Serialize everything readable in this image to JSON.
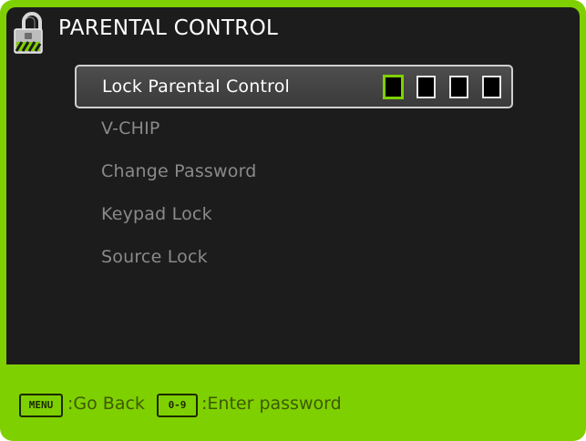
{
  "header": {
    "title": "PARENTAL CONTROL",
    "icon": "padlock-icon"
  },
  "menu": {
    "items": [
      {
        "label": "Lock Parental Control",
        "selected": true
      },
      {
        "label": "V-CHIP",
        "selected": false
      },
      {
        "label": "Change Password",
        "selected": false
      },
      {
        "label": "Keypad Lock",
        "selected": false
      },
      {
        "label": "Source Lock",
        "selected": false
      }
    ]
  },
  "password_entry": {
    "digits": [
      "",
      "",
      "",
      ""
    ],
    "active_index": 0
  },
  "footer": {
    "menu_key": "MENU",
    "menu_hint": ":Go Back",
    "digits_key": "0-9",
    "digits_hint": ":Enter password"
  },
  "colors": {
    "accent": "#7fd000",
    "panel": "#1c1c1c",
    "selected_text": "#ffffff",
    "unselected_text": "#8a8a8a"
  }
}
